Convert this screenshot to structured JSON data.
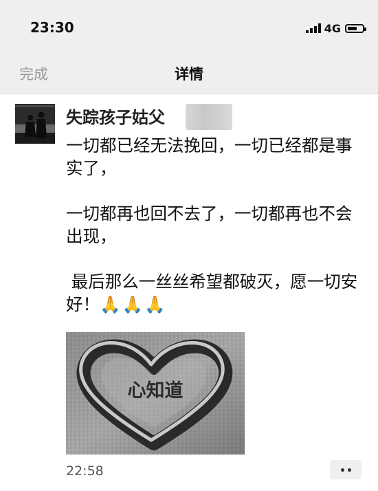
{
  "status_bar": {
    "time": "23:30",
    "network": "4G",
    "icons": [
      "signal-icon",
      "battery-icon"
    ]
  },
  "nav": {
    "done_label": "完成",
    "title": "详情"
  },
  "post": {
    "author_name": "失踪孩子姑父",
    "paragraphs": [
      "一切都已经无法挽回，一切已经都是事实了，",
      "一切都再也回不去了，一切都再也不会出现，",
      " 最后那么一丝丝希望都破灭，愿一切安好！"
    ],
    "emoji": "🙏🙏🙏",
    "image_text": "心知道",
    "time": "22:58",
    "more_icon": "more-dots-icon"
  }
}
